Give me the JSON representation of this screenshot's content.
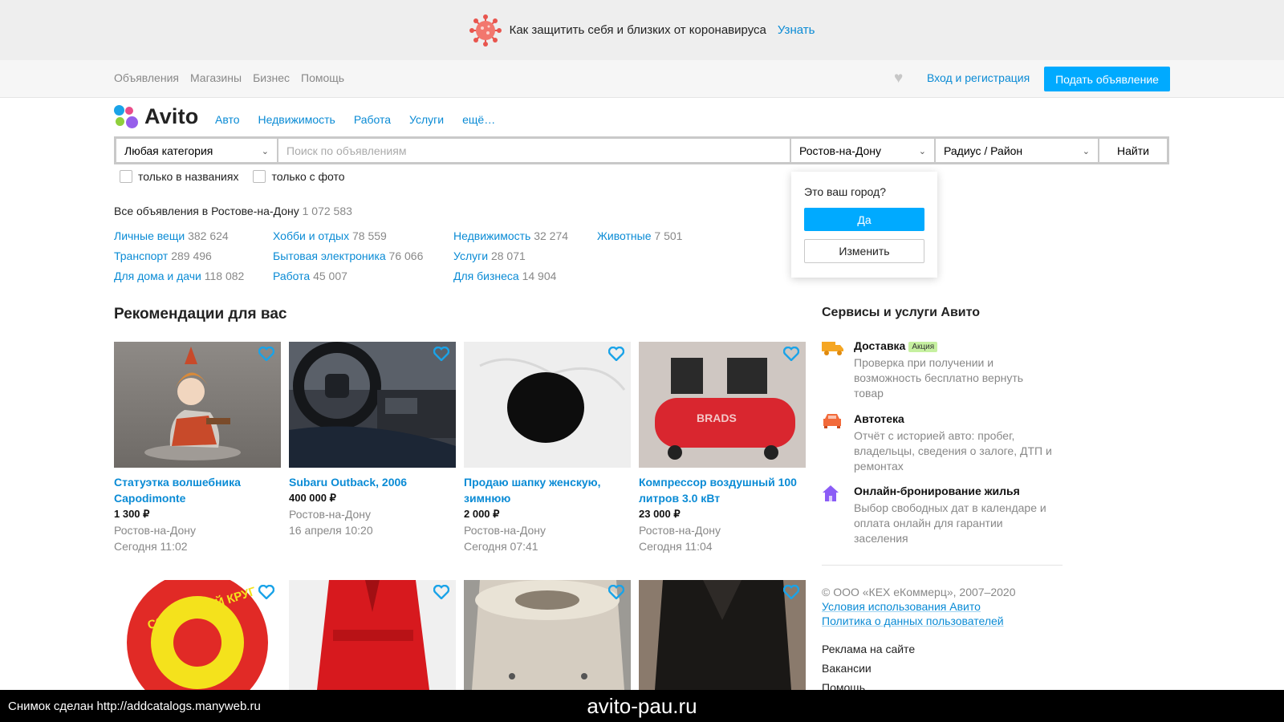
{
  "banner": {
    "text": "Как защитить себя и близких от коронавируса",
    "link": "Узнать"
  },
  "topnav": {
    "links": [
      "Объявления",
      "Магазины",
      "Бизнес",
      "Помощь"
    ],
    "login": "Вход и регистрация",
    "post_button": "Подать объявление"
  },
  "logo": {
    "text": "Avito"
  },
  "category_nav": [
    "Авто",
    "Недвижимость",
    "Работа",
    "Услуги",
    "ещё…"
  ],
  "search": {
    "category": "Любая категория",
    "placeholder": "Поиск по объявлениям",
    "city": "Ростов-на-Дону",
    "radius": "Радиус / Район",
    "button": "Найти"
  },
  "filters": [
    "только в названиях",
    "только с фото"
  ],
  "city_popup": {
    "question": "Это ваш город?",
    "yes": "Да",
    "change": "Изменить"
  },
  "all_ads": {
    "label": "Все объявления в Ростове-на-Дону",
    "count": "1 072 583"
  },
  "categories": [
    [
      {
        "name": "Личные вещи",
        "count": "382 624"
      },
      {
        "name": "Транспорт",
        "count": "289 496"
      },
      {
        "name": "Для дома и дачи",
        "count": "118 082"
      }
    ],
    [
      {
        "name": "Хобби и отдых",
        "count": "78 559"
      },
      {
        "name": "Бытовая электроника",
        "count": "76 066"
      },
      {
        "name": "Работа",
        "count": "45 007"
      }
    ],
    [
      {
        "name": "Недвижимость",
        "count": "32 274"
      },
      {
        "name": "Услуги",
        "count": "28 071"
      },
      {
        "name": "Для бизнеса",
        "count": "14 904"
      }
    ],
    [
      {
        "name": "Животные",
        "count": "7 501"
      }
    ]
  ],
  "recommendations": {
    "title": "Рекомендации для вас",
    "items": [
      {
        "title": "Статуэтка волшебника Capodimonte",
        "price": "1 300 ₽",
        "city": "Ростов-на-Дону",
        "date": "Сегодня 11:02"
      },
      {
        "title": "Subaru Outback, 2006",
        "price": "400 000 ₽",
        "city": "Ростов-на-Дону",
        "date": "16 апреля 10:20"
      },
      {
        "title": "Продаю шапку женскую, зимнюю",
        "price": "2 000 ₽",
        "city": "Ростов-на-Дону",
        "date": "Сегодня 07:41"
      },
      {
        "title": "Компрессор воздушный 100 литров 3.0 кВт",
        "price": "23 000 ₽",
        "city": "Ростов-на-Дону",
        "date": "Сегодня 11:04"
      }
    ],
    "second_row_image_text": "СОЛНЕЧНЫЙ КРУГ",
    "compressor_brand_text": "BRADS"
  },
  "services": {
    "title": "Сервисы и услуги Авито",
    "items": [
      {
        "name": "Доставка",
        "badge": "Акция",
        "desc": "Проверка при получении и возможность бесплатно вернуть товар",
        "icon": "truck-icon"
      },
      {
        "name": "Автотека",
        "desc": "Отчёт с историей авто: пробег, владельцы, сведения о залоге, ДТП и ремонтах",
        "icon": "car-icon"
      },
      {
        "name": "Онлайн-бронирование жилья",
        "desc": "Выбор свободных дат в календаре и оплата онлайн для гарантии заселения",
        "icon": "house-icon"
      }
    ]
  },
  "footer": {
    "copyright": "© ООО «КЕХ еКоммерц», 2007–2020",
    "terms": "Условия использования Авито",
    "privacy": "Политика о данных пользователей",
    "links": [
      "Реклама на сайте",
      "Вакансии",
      "Помощь"
    ]
  },
  "watermark": {
    "left": "Снимок сделан http://addcatalogs.manyweb.ru",
    "center": "avito-pau.ru"
  },
  "colors": {
    "accent": "#00aaff",
    "link": "#0a8bd5",
    "banner_bg": "#eeeeee"
  }
}
